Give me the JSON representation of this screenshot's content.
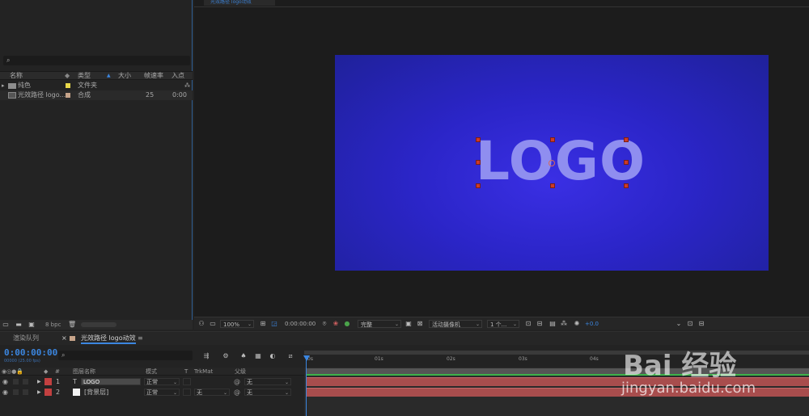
{
  "project": {
    "search_placeholder": "⌕",
    "columns": [
      "名称",
      "类型",
      "大小",
      "帧速率",
      "入点"
    ],
    "items": [
      {
        "name": "纯色",
        "type": "文件夹",
        "size": "",
        "fps": "",
        "in": "",
        "swatch": "#e8d84a"
      },
      {
        "name": "光效路径 logo...",
        "type": "合成",
        "size": "",
        "fps": "25",
        "in": "0:00",
        "swatch": "#c7a48a"
      }
    ],
    "bpc": "8 bpc"
  },
  "viewer": {
    "tab_label": "光效路径 logo动效",
    "logo_text": "LOGO",
    "toolbar": {
      "zoom": "100%",
      "timecode": "0:00:00:00",
      "resolution": "完整",
      "camera": "活动摄像机",
      "views": "1 个...",
      "exposure": "+0.0"
    }
  },
  "timeline": {
    "tabs": [
      "渲染队列",
      "光效路径 logo动效"
    ],
    "timecode": "0:00:00:00",
    "fps_label": "00000 (25.00 fps)",
    "search_placeholder": "⌕",
    "headers": {
      "num": "#",
      "layer_name": "图层名称",
      "mode": "模式",
      "t": "T",
      "trkmat": "TrkMat",
      "parent": "父级"
    },
    "layers": [
      {
        "num": "1",
        "type_glyph": "T",
        "name": "LOGO",
        "mode": "正常",
        "trkmat": "",
        "parent": "无",
        "color": "#c24040"
      },
      {
        "num": "2",
        "type_glyph": "",
        "name": "[背景层]",
        "mode": "正常",
        "trkmat": "无",
        "parent": "无",
        "color": "#c24040"
      }
    ],
    "ruler_ticks": [
      "0s",
      "01s",
      "02s",
      "03s",
      "04s"
    ]
  },
  "watermark": {
    "line1": "Bai  经验",
    "line2": "jingyan.baidu.com"
  },
  "colors": {
    "accent": "#3b86e0",
    "comp_bg": "#2b25c8",
    "logo": "#8f8ef0",
    "track": "#a84d4d",
    "handle": "#cc3a2a"
  }
}
